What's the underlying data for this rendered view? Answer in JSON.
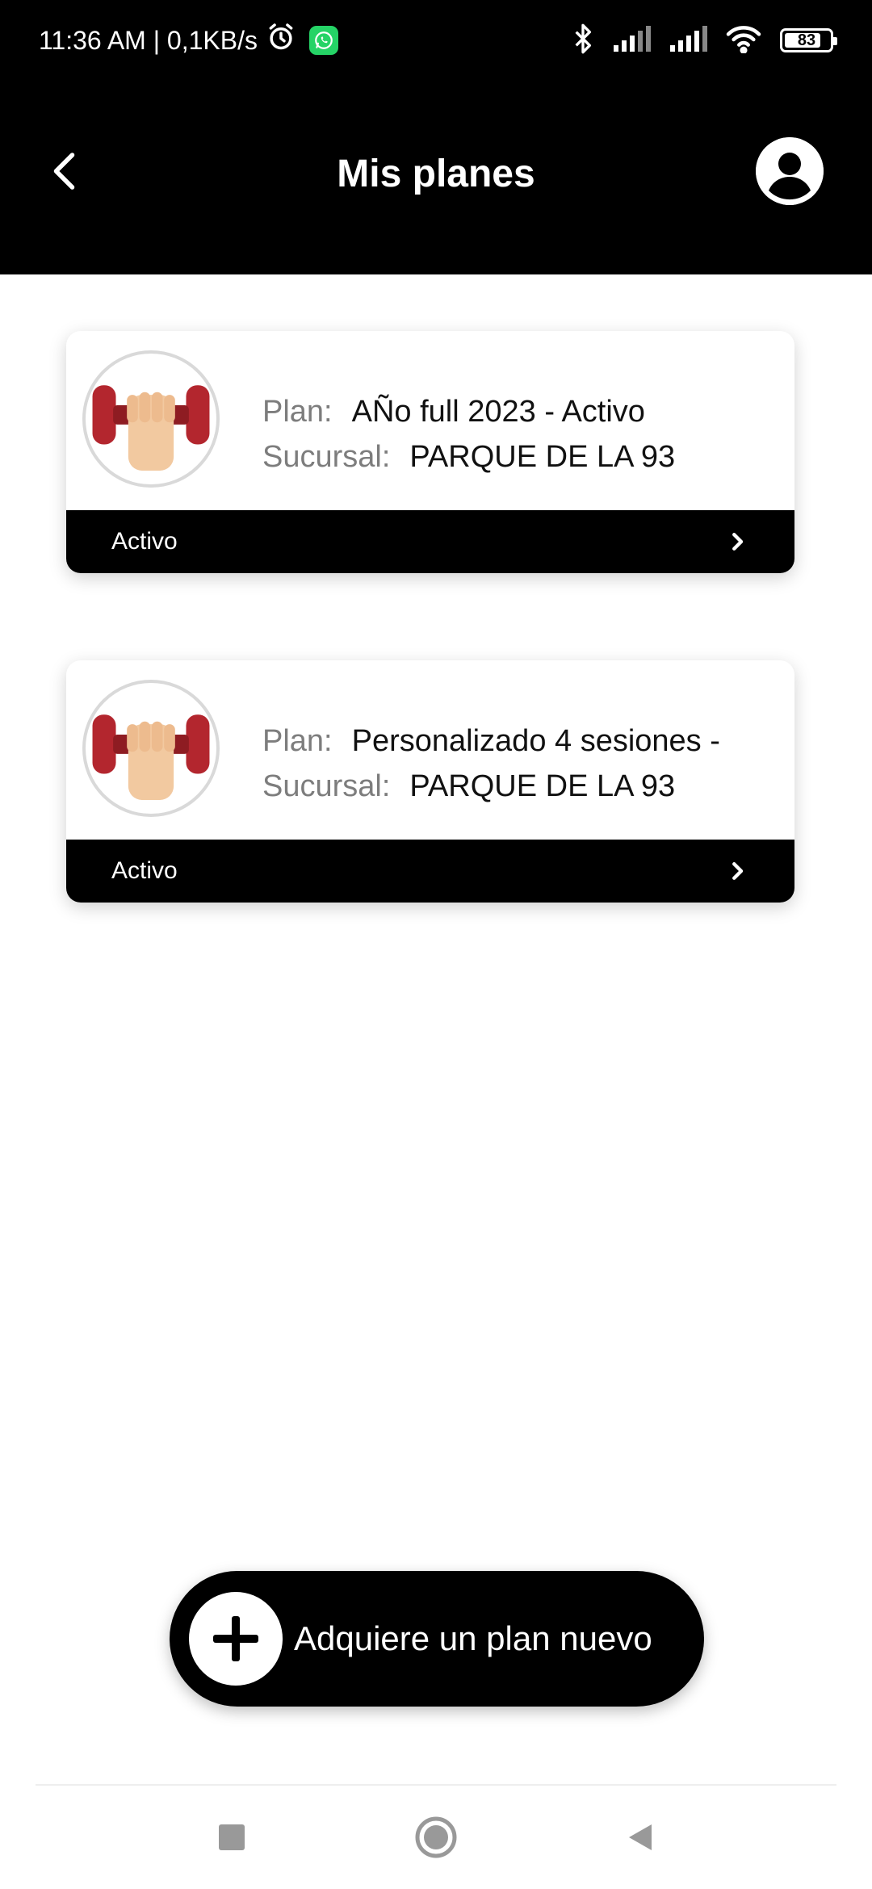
{
  "status_bar": {
    "time_speed": "11:36 AM | 0,1KB/s",
    "battery": "83",
    "battery_level": 0.83
  },
  "header": {
    "title": "Mis planes"
  },
  "plans": [
    {
      "plan_label": "Plan:",
      "plan_value": "AÑo full 2023 - Activo",
      "branch_label": "Sucursal:",
      "branch_value": "PARQUE DE LA 93",
      "status": "Activo"
    },
    {
      "plan_label": "Plan:",
      "plan_value": "Personalizado 4 sesiones -",
      "branch_label": "Sucursal:",
      "branch_value": "PARQUE DE LA 93",
      "status": "Activo"
    }
  ],
  "cta": {
    "label": "Adquiere un plan nuevo"
  },
  "colors": {
    "header_bg": "#000000",
    "dumbbell_red": "#B3262E",
    "whatsapp_green": "#25D366"
  },
  "icons": [
    "back-arrow-icon",
    "profile-icon",
    "alarm-icon",
    "whatsapp-icon",
    "bluetooth-icon",
    "signal-icon",
    "wifi-icon",
    "battery-icon",
    "dumbbell-icon",
    "chevron-right-icon",
    "plus-icon",
    "recents-icon",
    "home-icon",
    "nav-back-icon"
  ]
}
